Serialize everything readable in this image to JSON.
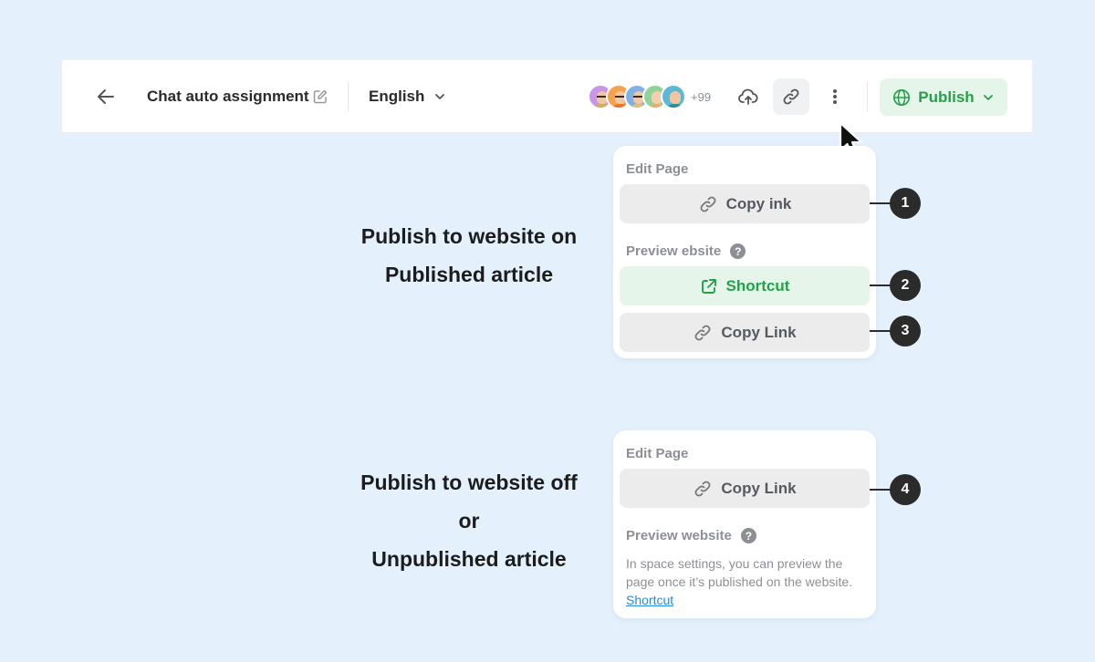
{
  "header": {
    "title": "Chat auto assignment",
    "language": "English",
    "collaborators_more": "+99",
    "publish_label": "Publish",
    "avatar_colors": [
      "#c995e8",
      "#f6a24a",
      "#7fb1e8",
      "#8fd39b",
      "#5bb8d6"
    ]
  },
  "published_state": {
    "heading_line1": "Publish to website on",
    "heading_line2": "Published article",
    "menu": {
      "edit_section": "Edit Page",
      "copy_link_edit": "Copy ink",
      "preview_section": "Preview ebsite",
      "help": "?",
      "shortcut": "Shortcut",
      "copy_link_preview": "Copy Link"
    },
    "badges": [
      "1",
      "2",
      "3"
    ]
  },
  "unpublished_state": {
    "heading_line1": "Publish to website off",
    "heading_line2": "or",
    "heading_line3": "Unpublished article",
    "menu": {
      "edit_section": "Edit Page",
      "copy_link": "Copy Link",
      "preview_section": "Preview website",
      "help": "?",
      "note": "In space settings, you can preview the page once it’s published on the website.",
      "shortcut_link": "Shortcut"
    },
    "badges": [
      "4"
    ]
  },
  "colors": {
    "background": "#e4f1fd",
    "green": "#24a148",
    "green_bg": "#e6f5ea",
    "badge": "#2b2b2b",
    "link": "#2a8bd8"
  }
}
